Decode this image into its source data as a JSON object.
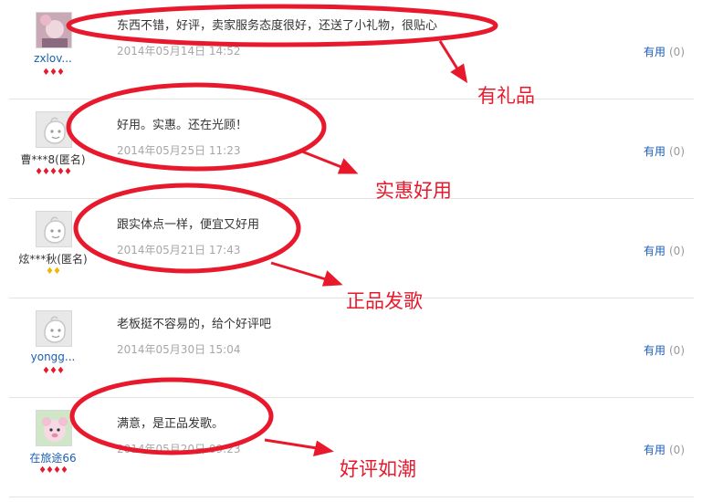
{
  "reviews": [
    {
      "username": "zxlov...",
      "user_style": "link",
      "rank": "♦♦♦",
      "rank_color": "red",
      "content": "东西不错，好评，卖家服务态度很好，还送了小礼物，很贴心",
      "date": "2014年05月14日 14:52",
      "useful_label": "有用",
      "useful_count": "(0)",
      "avatar": "photo-avatar-icon"
    },
    {
      "username": "曹***8(匿名)",
      "user_style": "plain",
      "rank": "♦♦♦♦♦",
      "rank_color": "red",
      "content": "好用。实惠。还在光顾！",
      "date": "2014年05月25日 11:23",
      "useful_label": "有用",
      "useful_count": "(0)",
      "avatar": "default-avatar-icon"
    },
    {
      "username": "炫***秋(匿名)",
      "user_style": "plain",
      "rank": "♦♦",
      "rank_color": "yellow",
      "content": "跟实体点一样，便宜又好用",
      "date": "2014年05月21日 17:43",
      "useful_label": "有用",
      "useful_count": "(0)",
      "avatar": "default-avatar-icon"
    },
    {
      "username": "yongg...",
      "user_style": "link",
      "rank": "♦♦♦",
      "rank_color": "red",
      "content": "老板挺不容易的，给个好评吧",
      "date": "2014年05月30日 15:04",
      "useful_label": "有用",
      "useful_count": "(0)",
      "avatar": "default-avatar-icon"
    },
    {
      "username": "在旅途66",
      "user_style": "link",
      "rank": "♦♦♦♦",
      "rank_color": "red",
      "content": "满意，是正品发歌。",
      "date": "2014年05月20日 09:23",
      "useful_label": "有用",
      "useful_count": "(0)",
      "avatar": "cartoon-avatar-icon"
    }
  ],
  "annotations": [
    "有礼品",
    "实惠好用",
    "正品发歌",
    "好评如潮"
  ],
  "colors": {
    "annotation": "#e8192c",
    "link": "#1b5eb5",
    "date": "#a7a7a7",
    "divider": "#e3e3e3"
  }
}
